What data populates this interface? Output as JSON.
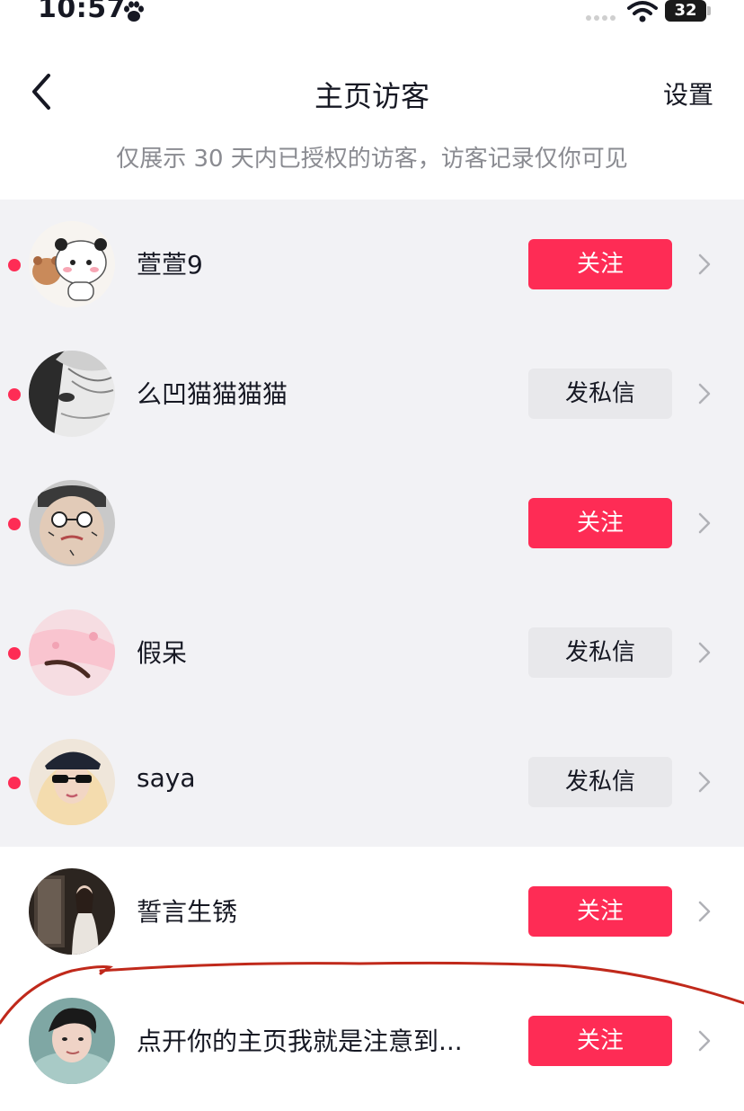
{
  "status_bar": {
    "time": "10:57",
    "battery_level": "32"
  },
  "nav": {
    "title": "主页访客",
    "settings_label": "设置"
  },
  "notice": "仅展示 30 天内已授权的访客，访客记录仅你可见",
  "visitors": [
    {
      "name": "萱萱9",
      "action": "关注",
      "unread": true
    },
    {
      "name": "么凹猫猫猫猫",
      "action": "发私信",
      "unread": true
    },
    {
      "name": "",
      "action": "关注",
      "unread": true
    },
    {
      "name": "假呆",
      "action": "发私信",
      "unread": true
    },
    {
      "name": "saya",
      "action": "发私信",
      "unread": true
    },
    {
      "name": "誓言生锈",
      "action": "关注",
      "unread": false
    },
    {
      "name": "点开你的主页我就是注意到...",
      "action": "关注",
      "unread": false
    }
  ],
  "colors": {
    "accent": "#fe2c55",
    "unread_row_bg": "#f2f2f5",
    "secondary_button_bg": "#e8e8eb",
    "annotation": "#c0291b"
  },
  "icons": {
    "back": "chevron-left-icon",
    "row_arrow": "chevron-right-icon",
    "status_paw": "paw-icon",
    "wifi": "wifi-icon"
  }
}
